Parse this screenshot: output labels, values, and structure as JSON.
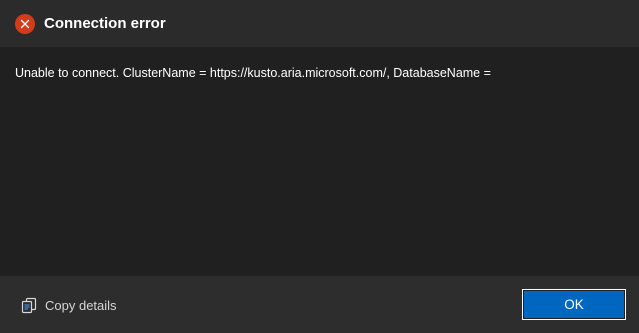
{
  "dialog": {
    "title": "Connection error",
    "message": "Unable to connect. ClusterName = https://kusto.aria.microsoft.com/, DatabaseName =",
    "icon": "error-icon",
    "accent_color": "#d13c1d"
  },
  "footer": {
    "copy_details_label": "Copy details",
    "copy_details_icon": "copy-icon",
    "ok_label": "OK",
    "ok_color": "#0067c0"
  }
}
